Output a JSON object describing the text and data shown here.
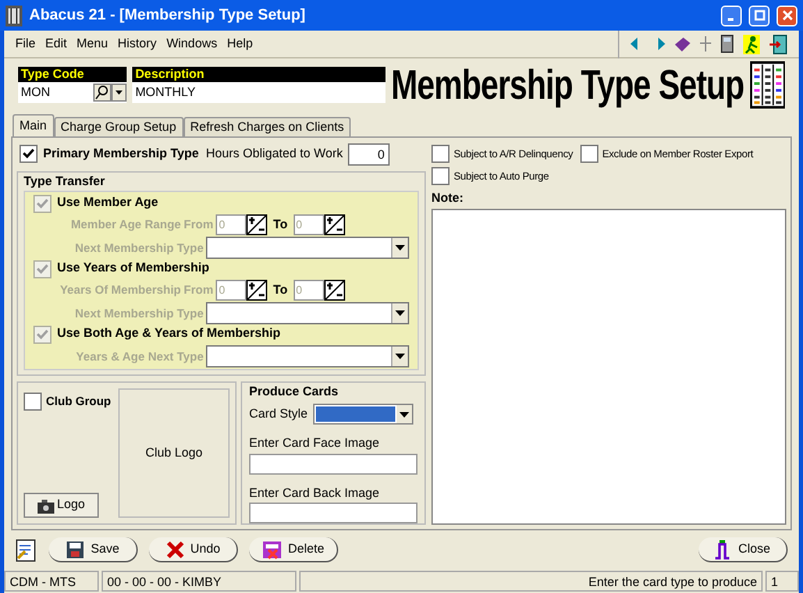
{
  "window": {
    "title": "Abacus 21 - [Membership Type Setup]"
  },
  "menu": [
    "File",
    "Edit",
    "Menu",
    "History",
    "Windows",
    "Help"
  ],
  "header": {
    "type_code": {
      "label": "Type Code",
      "value": "MON"
    },
    "description": {
      "label": "Description",
      "value": "MONTHLY"
    },
    "title": "Membership Type Setup"
  },
  "tabs": [
    {
      "label": "Main",
      "selected": true
    },
    {
      "label": "Charge Group Setup",
      "selected": false
    },
    {
      "label": "Refresh Charges on Clients",
      "selected": false
    }
  ],
  "primary": {
    "label": "Primary Membership Type",
    "checked": true
  },
  "hours": {
    "label": "Hours Obligated to Work",
    "value": "0"
  },
  "type_transfer": {
    "title": "Type Transfer",
    "sections": [
      {
        "kind": "range",
        "label": "Use Member Age",
        "checked": true,
        "disabled": true,
        "range_label": "Member Age Range",
        "from_label": "From",
        "from": "0",
        "to_label": "To",
        "to": "0",
        "next_label": "Next Membership Type"
      },
      {
        "kind": "range",
        "label": "Use Years of Membership",
        "checked": true,
        "disabled": true,
        "range_label": "Years Of Membership",
        "from_label": "From",
        "from": "0",
        "to_label": "To",
        "to": "0",
        "next_label": "Next Membership Type"
      },
      {
        "kind": "both",
        "label": "Use Both Age & Years of Membership",
        "checked": true,
        "disabled": true,
        "next_label": "Years & Age Next Type"
      }
    ]
  },
  "club": {
    "label": "Club Group",
    "checked": false,
    "logo_label": "Club Logo",
    "button": "Logo"
  },
  "cards": {
    "title": "Produce Cards",
    "style_label": "Card Style",
    "face_label": "Enter Card Face Image",
    "back_label": "Enter Card Back Image"
  },
  "options": [
    {
      "label": "Subject to A/R Delinquency",
      "checked": false
    },
    {
      "label": "Exclude on Member Roster Export",
      "checked": false
    },
    {
      "label": "Subject to Auto Purge",
      "checked": false
    }
  ],
  "note_label": "Note:",
  "buttons": [
    {
      "label": "Save",
      "kind": "save"
    },
    {
      "label": "Undo",
      "kind": "undo"
    },
    {
      "label": "Delete",
      "kind": "delete"
    }
  ],
  "close_button": "Close",
  "status_bar": [
    "CDM - MTS",
    "00 - 00 - 00 - KIMBY",
    "Enter the card type to produce",
    "1"
  ]
}
